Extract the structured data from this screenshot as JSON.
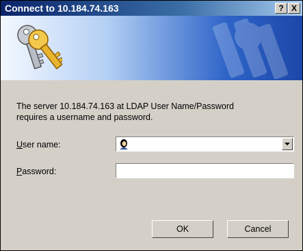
{
  "window": {
    "title": "Connect to 10.184.74.163",
    "help_button": "?",
    "close_button": "X"
  },
  "banner": {
    "icon": "keys-icon"
  },
  "message": {
    "line1": "The server 10.184.74.163 at LDAP User Name/Password",
    "line2": "requires a username and password."
  },
  "form": {
    "username": {
      "label_prefix": "",
      "label_hotkey": "U",
      "label_rest": "ser name:",
      "value": "",
      "icon": "user-icon",
      "dropdown_icon": "chevron-down-icon"
    },
    "password": {
      "label_prefix": "",
      "label_hotkey": "P",
      "label_rest": "assword:",
      "value": ""
    }
  },
  "buttons": {
    "ok": "OK",
    "cancel": "Cancel"
  }
}
